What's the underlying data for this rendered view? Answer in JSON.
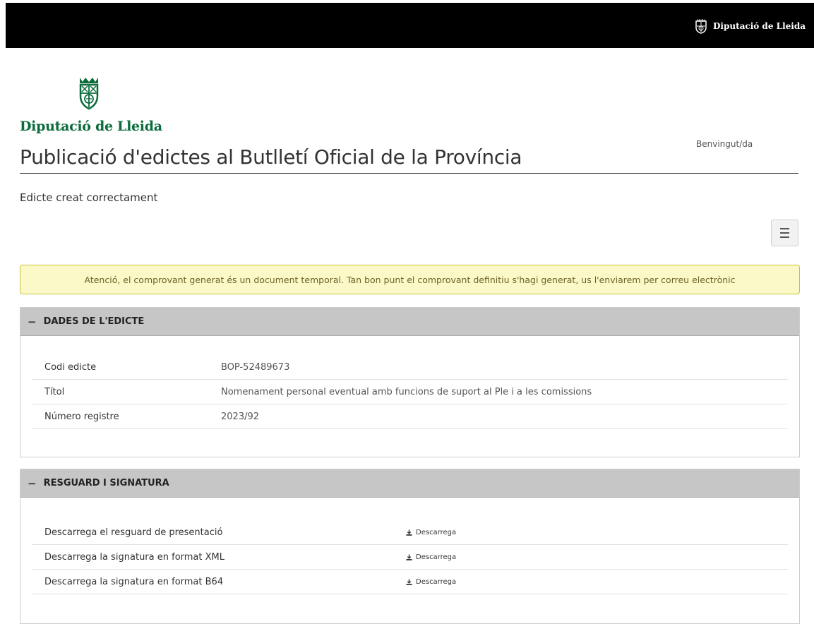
{
  "header": {
    "brand": "Diputació de Lleida"
  },
  "logo": {
    "text": "Diputació de Lleida"
  },
  "user": {
    "welcome": "Benvingut/da"
  },
  "page": {
    "title": "Publicació d'edictes al Butlletí Oficial de la Província",
    "status": "Edicte creat correctament"
  },
  "alert": {
    "text": "Atenció, el comprovant generat és un document temporal. Tan bon punt el comprovant definitiu s'hagi generat, us l'enviarem per correu electrònic"
  },
  "edict_panel": {
    "toggle": "−",
    "title": "DADES DE L'EDICTE",
    "rows": [
      {
        "label": "Codi edicte",
        "value": "BOP-52489673"
      },
      {
        "label": "Títol",
        "value": "Nomenament personal eventual amb funcions de suport al Ple i a les comissions"
      },
      {
        "label": "Número registre",
        "value": "2023/92"
      }
    ]
  },
  "signature_panel": {
    "toggle": "−",
    "title": "RESGUARD I SIGNATURA",
    "rows": [
      {
        "label": "Descarrega el resguard de presentació",
        "link": "Descarrega"
      },
      {
        "label": "Descarrega la signatura en format XML",
        "link": "Descarrega"
      },
      {
        "label": "Descarrega la signatura en format B64",
        "link": "Descarrega"
      }
    ]
  },
  "icons": {
    "menu": "hamburger-icon",
    "download": "download-icon",
    "emblem": "coat-of-arms-icon"
  },
  "colors": {
    "topbar": "#000000",
    "brand_green": "#0b6b3a",
    "alert_bg": "#fcf9c9",
    "alert_border": "#c9c136",
    "panel_header": "#c6c6c6"
  }
}
